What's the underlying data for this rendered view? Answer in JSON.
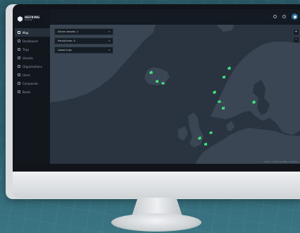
{
  "app": {
    "logo_name": "HEFRING",
    "logo_sub": "MARINE"
  },
  "sidebar": {
    "items": [
      {
        "label": "Map",
        "icon": "map-icon",
        "active": true
      },
      {
        "label": "Dashboard",
        "icon": "dashboard-icon",
        "active": false
      },
      {
        "label": "Trips",
        "icon": "trips-icon",
        "active": false
      },
      {
        "label": "Vessels",
        "icon": "vessel-icon",
        "active": false
      },
      {
        "label": "Organizations",
        "icon": "organization-icon",
        "active": false
      },
      {
        "label": "Users",
        "icon": "users-icon",
        "active": false
      },
      {
        "label": "Companies",
        "icon": "companies-icon",
        "active": false
      },
      {
        "label": "Boats",
        "icon": "boats-icon",
        "active": false
      }
    ]
  },
  "filters": {
    "active_vessels": "Active vessels: 1",
    "period": "Period from: 4",
    "latest": "Latest trips"
  },
  "map": {
    "zoom_in": "+",
    "zoom_out": "–",
    "attribution": "Leaflet | © OpenStreetMap contributors",
    "vessel_color": "#3ee27a"
  }
}
